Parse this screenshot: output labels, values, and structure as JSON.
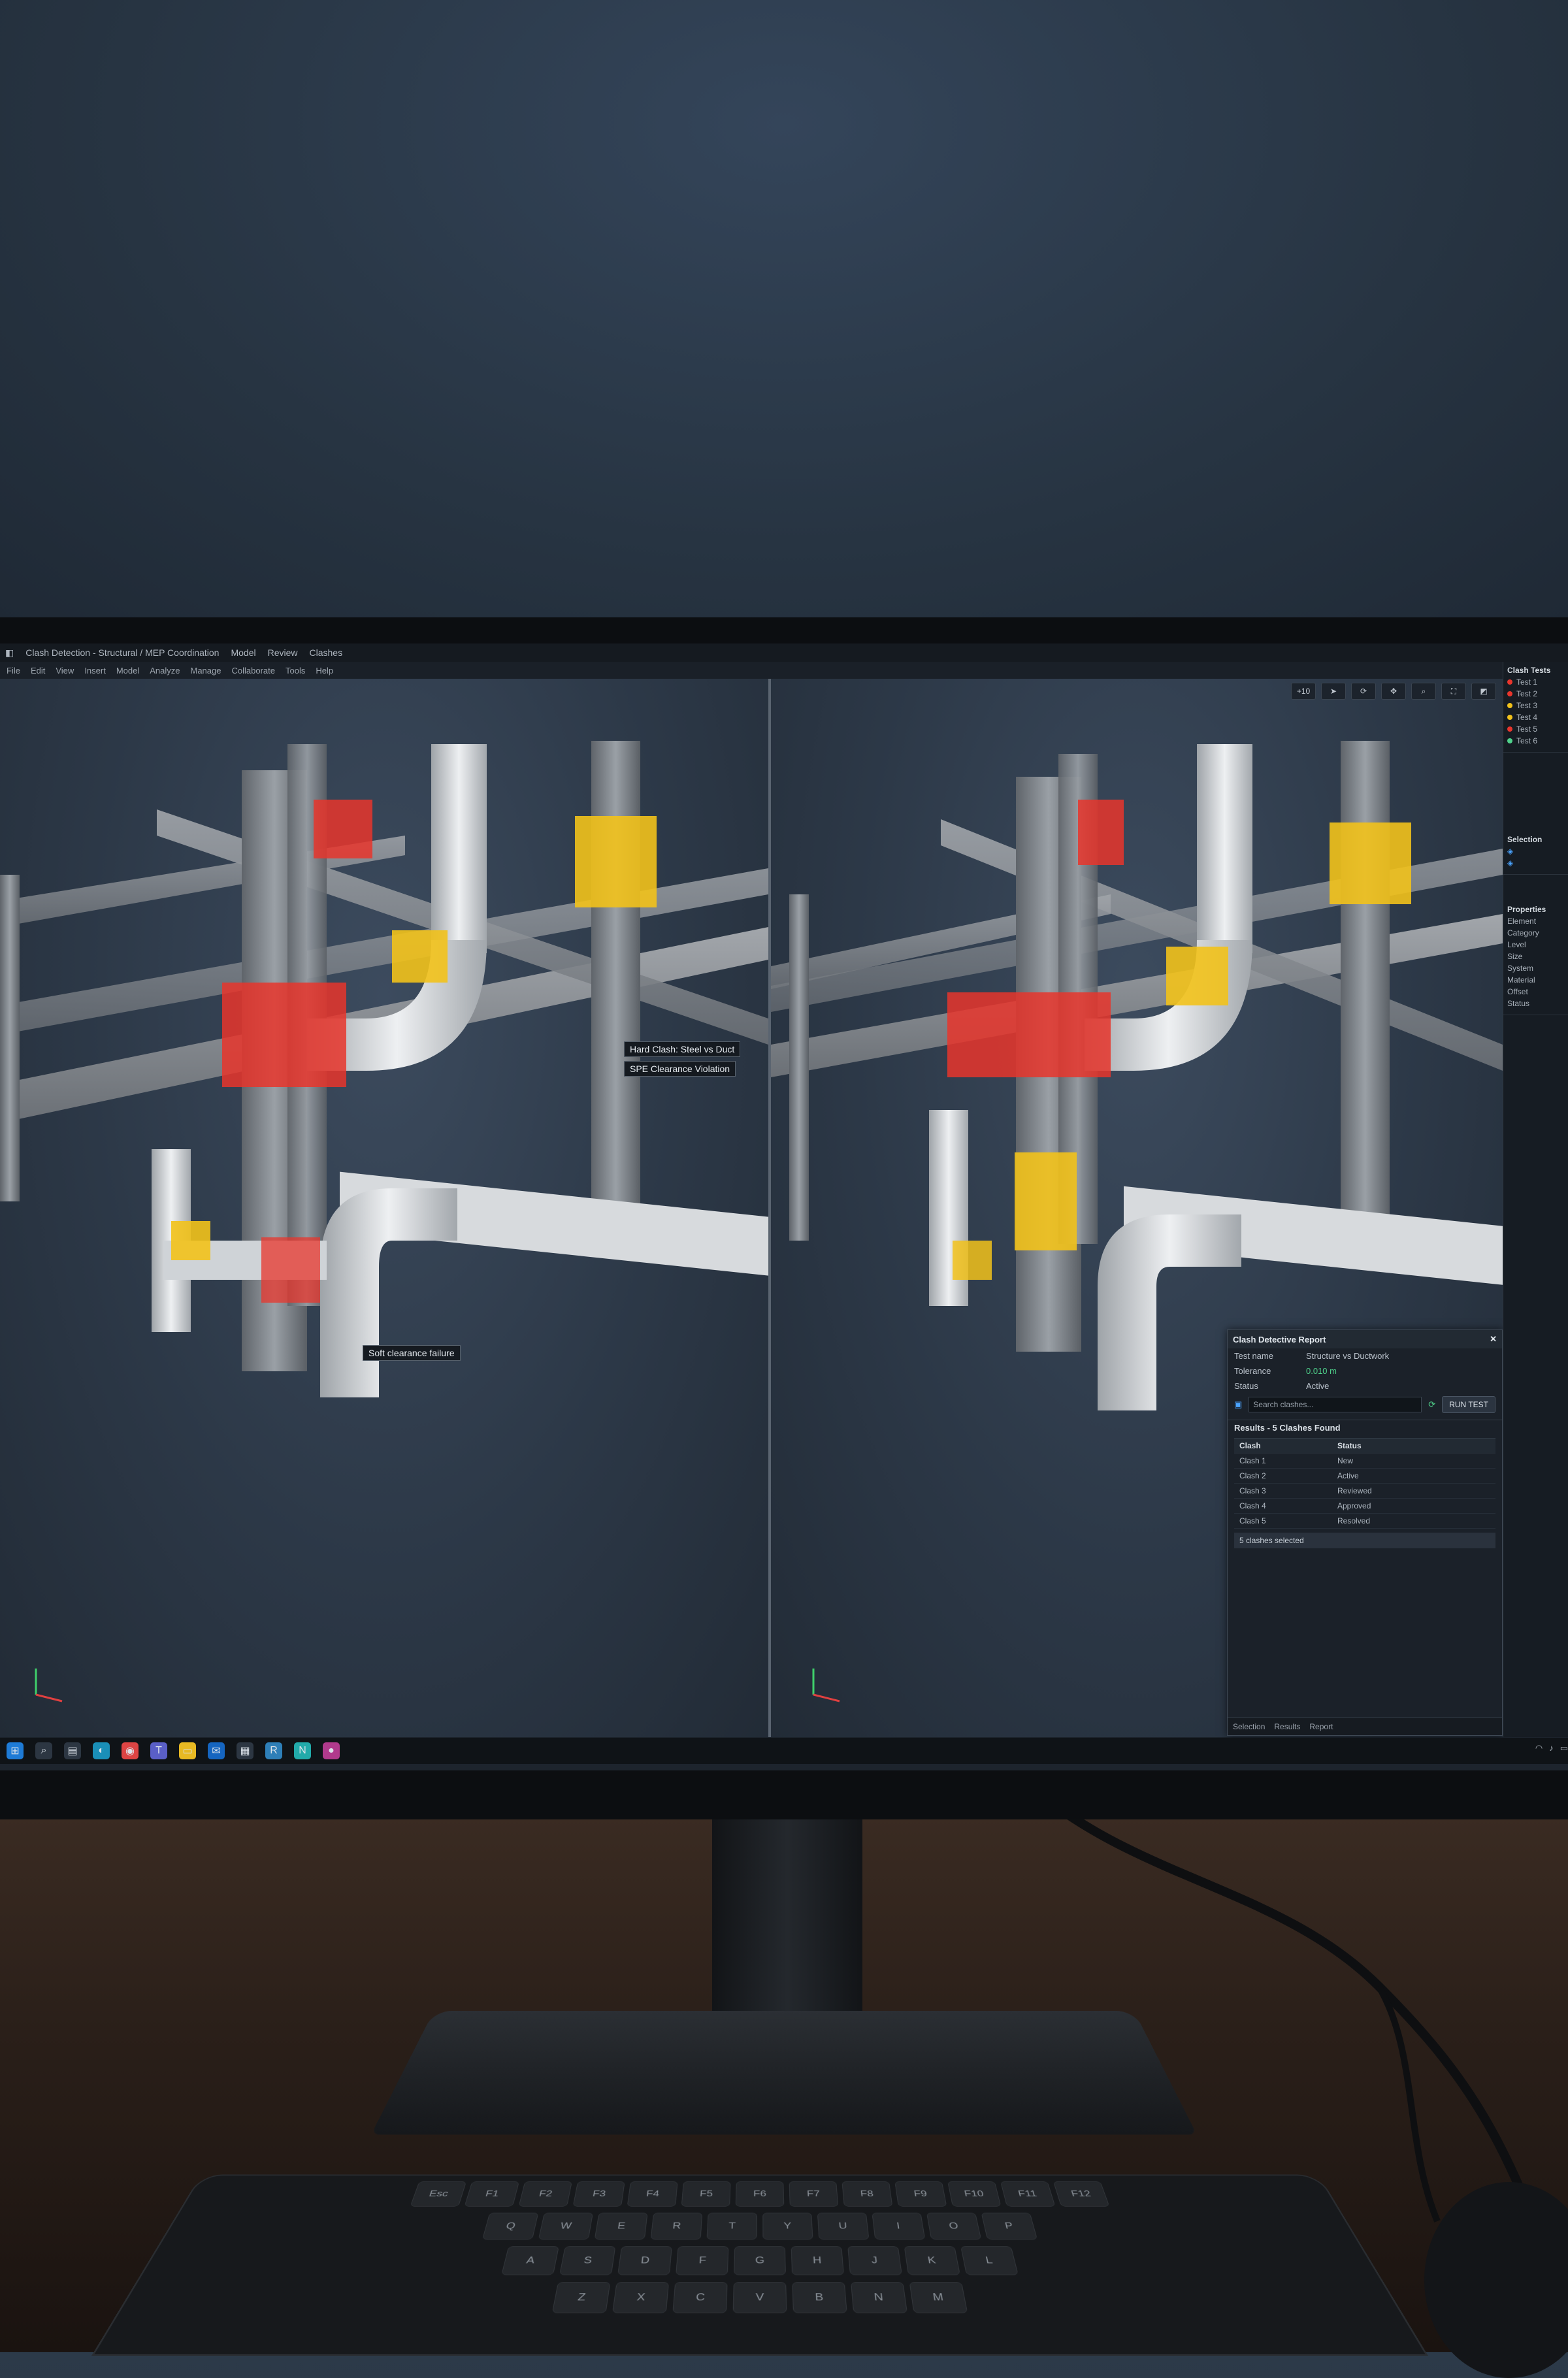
{
  "window": {
    "title": "Clash Detection - Structural / MEP Coordination",
    "tabs": [
      "Model",
      "Review",
      "Clashes"
    ]
  },
  "menu": [
    "File",
    "Edit",
    "View",
    "Insert",
    "Model",
    "Analyze",
    "Manage",
    "Collaborate",
    "Tools",
    "Help"
  ],
  "viewport_toolbar": {
    "zoom_label": "+10",
    "buttons": [
      "cursor",
      "orbit",
      "pan",
      "zoom",
      "fit",
      "section"
    ]
  },
  "callouts": {
    "left_top_1": "Hard Clash: Steel vs Duct",
    "left_top_2": "SPE Clearance Violation",
    "left_bottom": "Soft clearance failure"
  },
  "side_panel": {
    "title": "Clash Tests",
    "tests": [
      {
        "label": "Test 1",
        "status": "red"
      },
      {
        "label": "Test 2",
        "status": "red"
      },
      {
        "label": "Test 3",
        "status": "yellow"
      },
      {
        "label": "Test 4",
        "status": "yellow"
      },
      {
        "label": "Test 5",
        "status": "red"
      },
      {
        "label": "Test 6",
        "status": "green"
      }
    ],
    "section2_title": "Selection",
    "section3_title": "Properties",
    "props": [
      "Element",
      "Category",
      "Level",
      "Size",
      "System",
      "Material",
      "Offset",
      "Status"
    ]
  },
  "clash_panel": {
    "title": "Clash Detective Report",
    "row1_label": "Test name",
    "row1_value": "Structure vs Ductwork",
    "row2_label": "Tolerance",
    "row2_value": "0.010 m",
    "row3_label": "Status",
    "row3_value": "Active",
    "search_placeholder": "Search clashes...",
    "run_button": "RUN TEST",
    "results_title": "Results - 5 Clashes Found",
    "col1": "Clash",
    "col2": "Status",
    "rows": [
      {
        "name": "Clash 1",
        "status": "New"
      },
      {
        "name": "Clash 2",
        "status": "Active"
      },
      {
        "name": "Clash 3",
        "status": "Reviewed"
      },
      {
        "name": "Clash 4",
        "status": "Approved"
      },
      {
        "name": "Clash 5",
        "status": "Resolved"
      }
    ],
    "status_bar": "5 clashes selected",
    "footer": [
      "Selection",
      "Results",
      "Report"
    ]
  },
  "taskbar_icons": [
    "start",
    "search",
    "files",
    "edge",
    "chrome",
    "teams",
    "explorer",
    "outlook",
    "store",
    "revit",
    "navisworks",
    "media"
  ],
  "tray": [
    "wifi",
    "vol",
    "batt"
  ],
  "keyboard_rows": [
    [
      "Esc",
      "F1",
      "F2",
      "F3",
      "F4",
      "F5",
      "F6",
      "F7",
      "F8",
      "F9",
      "F10",
      "F11",
      "F12"
    ],
    [
      "Q",
      "W",
      "E",
      "R",
      "T",
      "Y",
      "U",
      "I",
      "O",
      "P"
    ],
    [
      "A",
      "S",
      "D",
      "F",
      "G",
      "H",
      "J",
      "K",
      "L"
    ],
    [
      "Z",
      "X",
      "C",
      "V",
      "B",
      "N",
      "M"
    ]
  ],
  "colors": {
    "hard_clash": "#e8352c",
    "soft_clash": "#f2c21b",
    "steel": "#8a8f95",
    "duct": "#d8dadd"
  }
}
